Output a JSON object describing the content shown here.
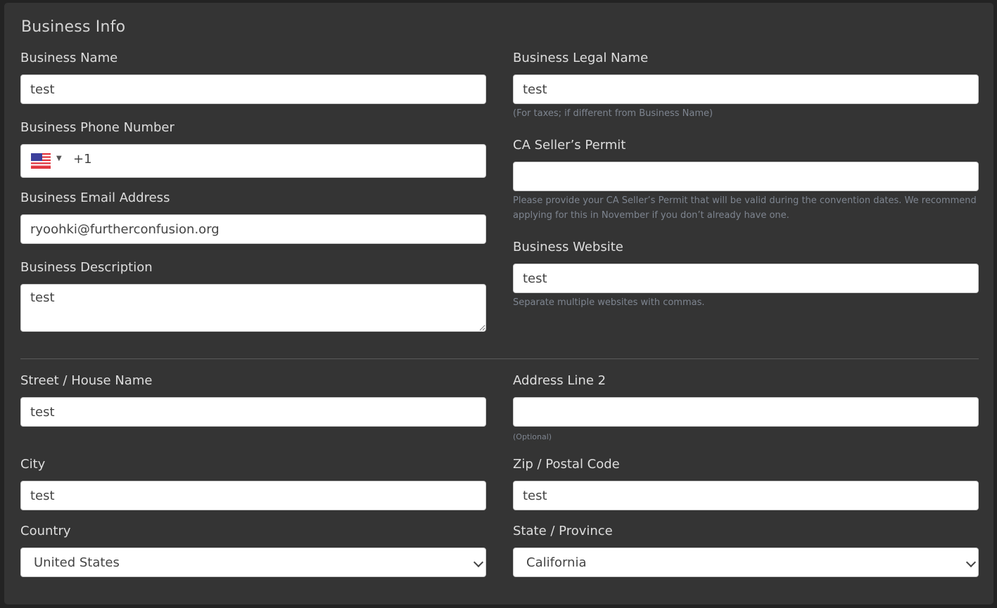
{
  "section_title": "Business Info",
  "fields": {
    "business_name": {
      "label": "Business Name",
      "value": "test"
    },
    "business_legal_name": {
      "label": "Business Legal Name",
      "value": "test",
      "help": "(For taxes; if different from Business Name)"
    },
    "business_phone": {
      "label": "Business Phone Number",
      "country_flag": "us-flag-icon",
      "dial_code": "+1",
      "value": ""
    },
    "ca_sellers_permit": {
      "label": "CA Seller’s Permit",
      "value": "",
      "help": "Please provide your CA Seller’s Permit that will be valid during the convention dates. We recommend applying for this in November if you don’t already have one."
    },
    "business_email": {
      "label": "Business Email Address",
      "value": "ryoohki@furtherconfusion.org"
    },
    "business_website": {
      "label": "Business Website",
      "value": "test",
      "help": "Separate multiple websites with commas."
    },
    "business_description": {
      "label": "Business Description",
      "value": "test"
    },
    "street": {
      "label": "Street / House Name",
      "value": "test"
    },
    "address_line2": {
      "label": "Address Line 2",
      "value": "",
      "help": "(Optional)"
    },
    "city": {
      "label": "City",
      "value": "test"
    },
    "zip": {
      "label": "Zip / Postal Code",
      "value": "test"
    },
    "country": {
      "label": "Country",
      "selected": "United States"
    },
    "state": {
      "label": "State / Province",
      "selected": "California"
    }
  }
}
